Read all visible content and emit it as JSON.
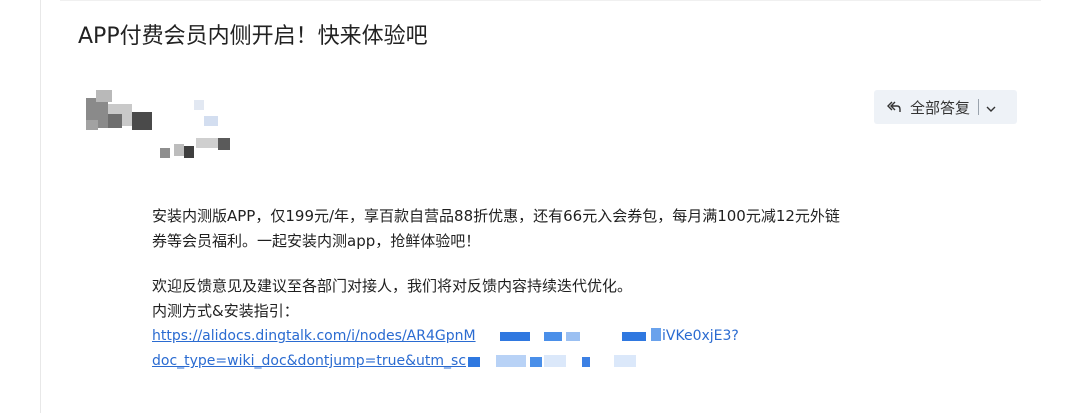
{
  "email": {
    "subject": "APP付费会员内侧开启！快来体验吧",
    "reply_all_label": "全部答复",
    "body": {
      "paragraph1_line1": "安装内测版APP，仅199元/年，享百款自营品88折优惠，还有66元入会券包，每月满100元减12元外链",
      "paragraph1_line2": "券等会员福利。一起安装内测app，抢鲜体验吧！",
      "paragraph2": "欢迎反馈意见及建议至各部门对接人，我们将对反馈内容持续迭代优化。",
      "guide_label": "内测方式&安装指引：",
      "link_line1_start": "https://alidocs.dingtalk.com/i/nodes/AR4GpnM",
      "link_line1_end": "iVKe0xjE3?",
      "link_line2_start": "doc_type=wiki_doc&dontjump=true&utm_sc"
    }
  },
  "colors": {
    "link": "#2a6bd1",
    "reply_bg": "#eef2f7"
  },
  "icons": {
    "reply_all": "reply-all-icon",
    "dropdown": "chevron-down-icon"
  }
}
